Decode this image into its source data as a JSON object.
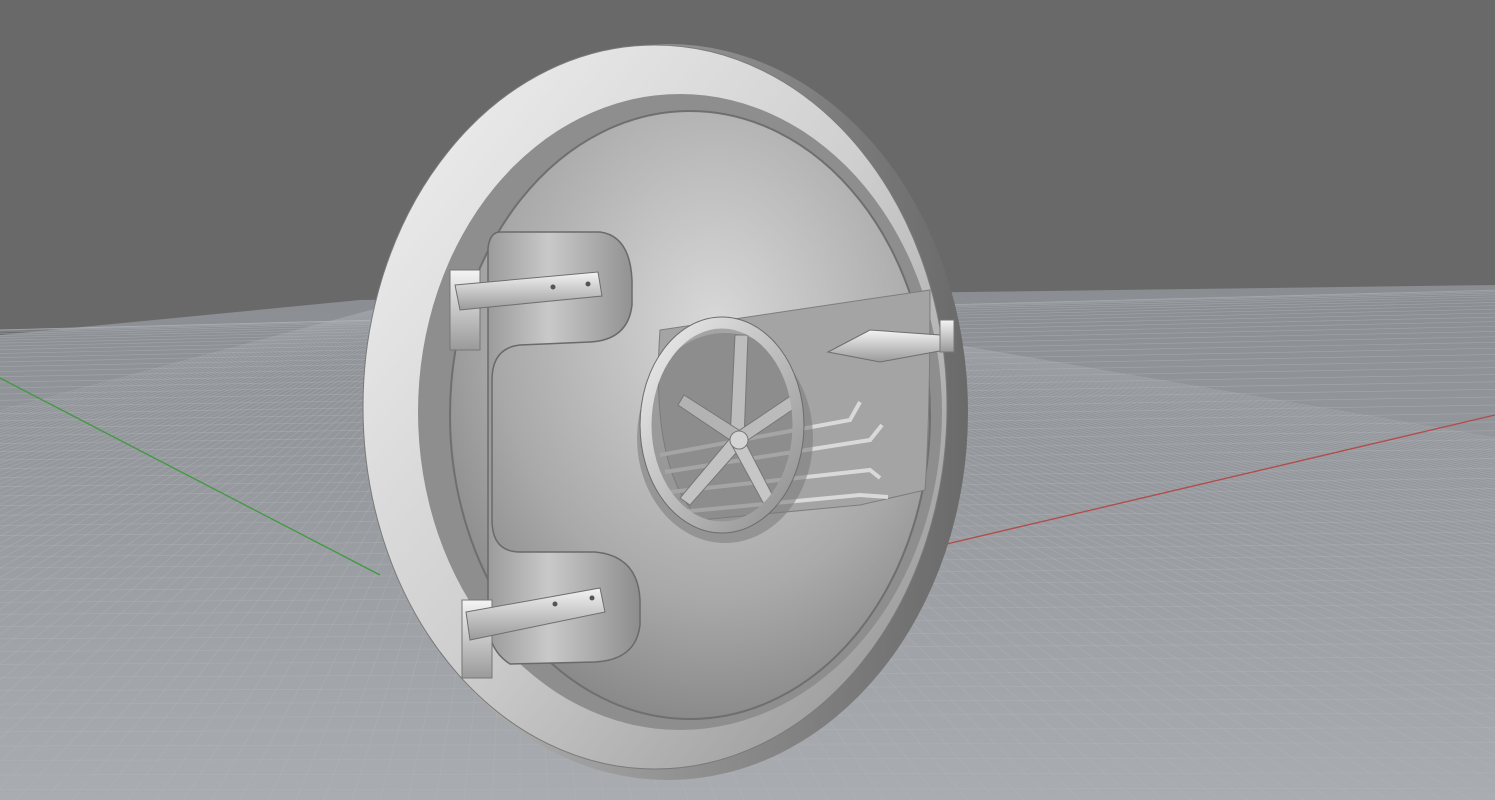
{
  "viewport": {
    "view": "perspective",
    "shading": "shaded",
    "background_color": "#696969",
    "grid_color": "#b3b8bd",
    "x_axis_color": "#b44a4a",
    "y_axis_color": "#3f9a3f"
  },
  "scene": {
    "object": "vault-door",
    "parts": [
      "door-frame-ring",
      "door-panel",
      "upper-hinge",
      "lower-hinge",
      "hand-wheel",
      "locking-bolts",
      "latch-handle"
    ],
    "hand_wheel_spokes": 5,
    "locking_bolts": 4,
    "hinges": 2
  }
}
